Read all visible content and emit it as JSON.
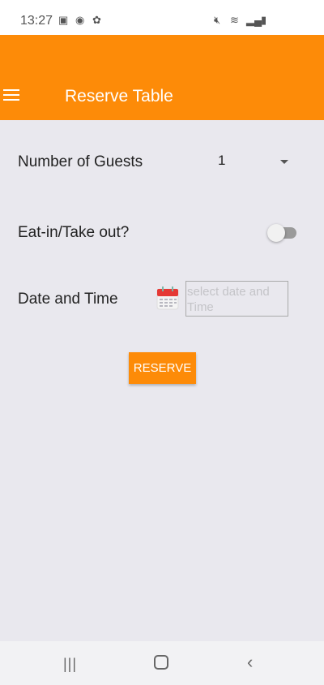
{
  "status_bar": {
    "time": "13:27"
  },
  "header": {
    "title": "Reserve Table"
  },
  "form": {
    "guests_label": "Number of Guests",
    "guests_value": "1",
    "eat_label": "Eat-in/Take out?",
    "eat_toggle_on": false,
    "date_label": "Date and Time",
    "date_placeholder": "select date and Time",
    "reserve_label": "RESERVE"
  },
  "colors": {
    "accent": "#fd8b08",
    "background": "#e9e8ee"
  }
}
